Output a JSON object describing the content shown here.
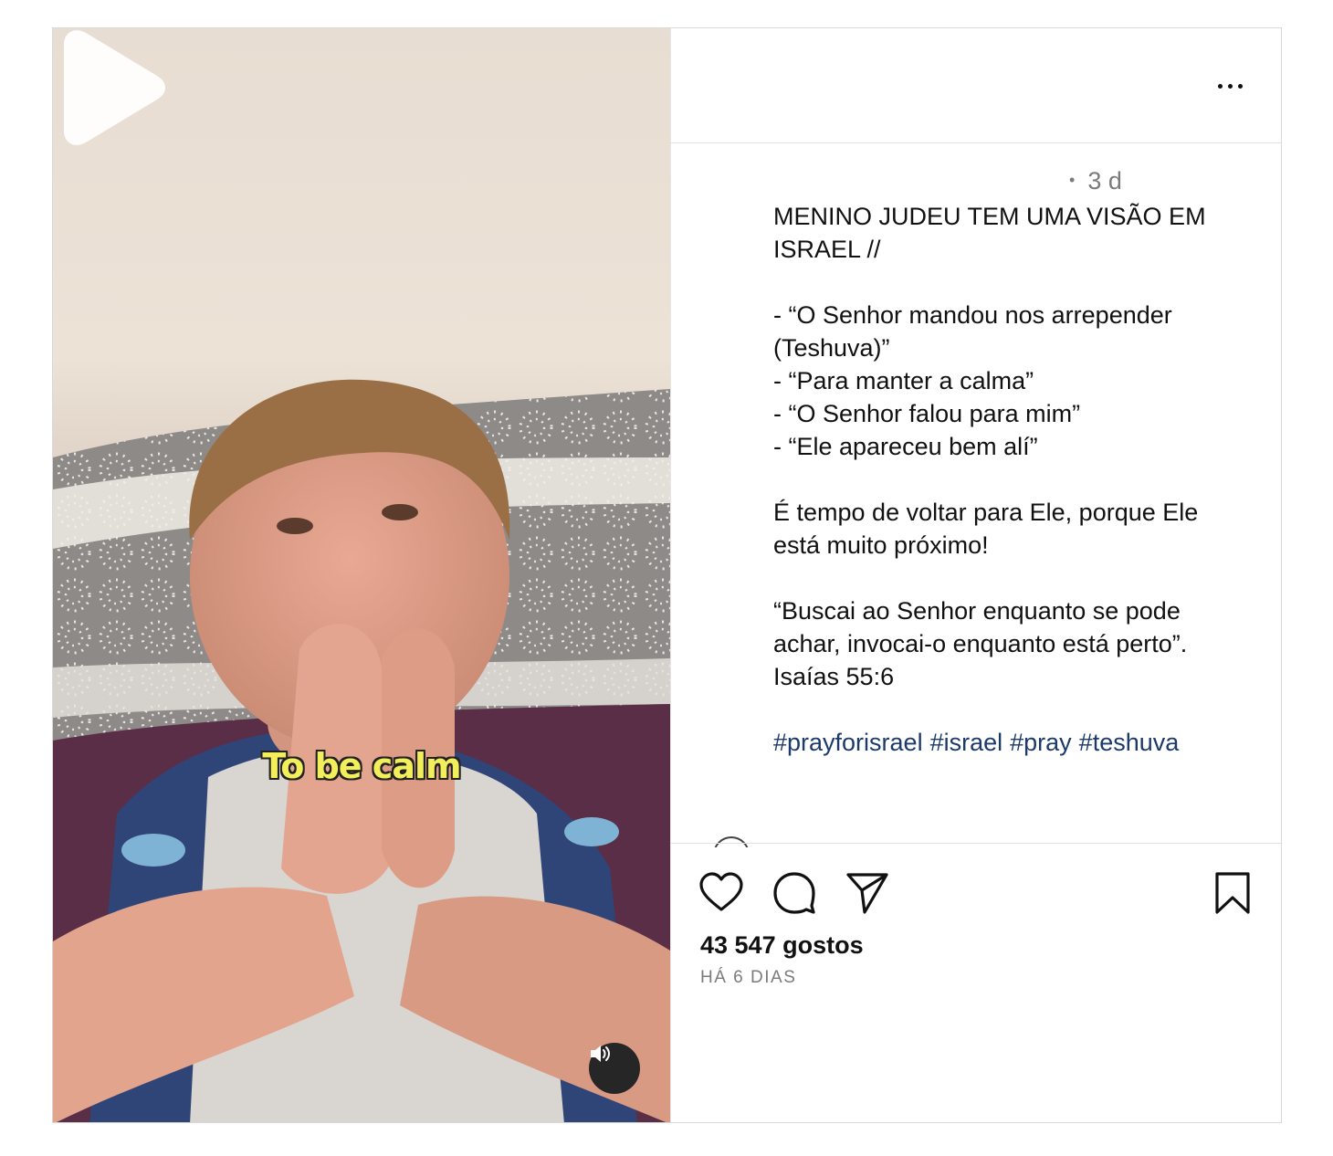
{
  "video": {
    "overlay_caption": "To be calm",
    "play_icon": "play-icon",
    "mute_icon": "speaker-icon"
  },
  "post": {
    "timestamp": "3 d",
    "separator": "•",
    "caption": {
      "title_line1": "MENINO JUDEU TEM UMA VISÃO EM",
      "title_line2": "ISRAEL //",
      "quote1_line1": "- “O Senhor mandou nos arrepender",
      "quote1_line2": "(Teshuva)”",
      "quote2": "- “Para manter a calma”",
      "quote3": "- “O Senhor falou para mim”",
      "quote4": "- “Ele apareceu bem alí”",
      "para2_line1": "É tempo de voltar para Ele, porque Ele",
      "para2_line2": "está muito próximo!",
      "verse_line1": "“Buscai ao Senhor enquanto se pode",
      "verse_line2": "achar, invocai-o enquanto está perto”.",
      "verse_line3": "Isaías 55:6"
    },
    "hashtags": [
      "#prayforisrael",
      "#israel",
      "#pray",
      "#teshuva"
    ],
    "likes": "43 547 gostos",
    "date": "HÁ 6 DIAS"
  },
  "icons": {
    "more": "more-options-icon",
    "like": "heart-icon",
    "comment": "comment-icon",
    "share": "send-icon",
    "save": "bookmark-icon"
  },
  "colors": {
    "hashtag": "#1b3a6b",
    "muted_text": "#7b7b7b",
    "caption_overlay": "#f3ef5a"
  }
}
